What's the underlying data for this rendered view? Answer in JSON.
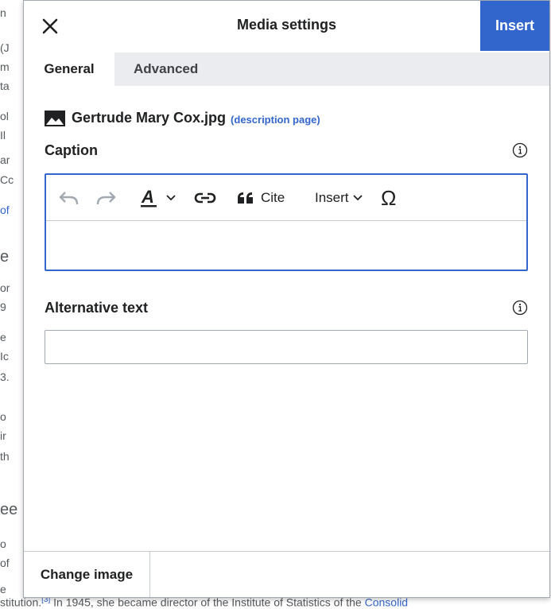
{
  "background": {
    "left_fragments": [
      "n",
      "(J",
      "m",
      "ta",
      "ol",
      "Il",
      "ar",
      "Cc",
      "of",
      "e",
      "or",
      "9",
      "e",
      "Ic",
      "3.",
      "o",
      "ir",
      "th",
      "ee",
      "o",
      "of",
      "e"
    ],
    "bottom_text": {
      "before": "stitution.",
      "ref": "[3]",
      "after": " In 1945, she became director of the Institute of Statistics of the ",
      "link": "Consolid"
    }
  },
  "dialog": {
    "title": "Media settings",
    "insert_label": "Insert",
    "tabs": [
      {
        "label": "General",
        "active": true
      },
      {
        "label": "Advanced",
        "active": false
      }
    ],
    "file": {
      "name": "Gertrude Mary Cox.jpg",
      "description_link": "(description page)"
    },
    "caption": {
      "label": "Caption",
      "toolbar": {
        "cite_label": "Cite",
        "insert_label": "Insert",
        "special_char": "Ω"
      },
      "value": ""
    },
    "alt_text": {
      "label": "Alternative text",
      "value": ""
    },
    "change_image_label": "Change image"
  },
  "icons": {
    "close": "close-icon",
    "image": "image-icon",
    "info": "info-icon",
    "undo": "undo-icon",
    "redo": "redo-icon",
    "text_style": "text-style-icon",
    "link": "link-icon",
    "quote": "quote-icon"
  },
  "colors": {
    "accent": "#3366cc",
    "border": "#a2a9b1",
    "tabbar": "#eaecf0",
    "disabled_icon": "#a2a9b1"
  }
}
